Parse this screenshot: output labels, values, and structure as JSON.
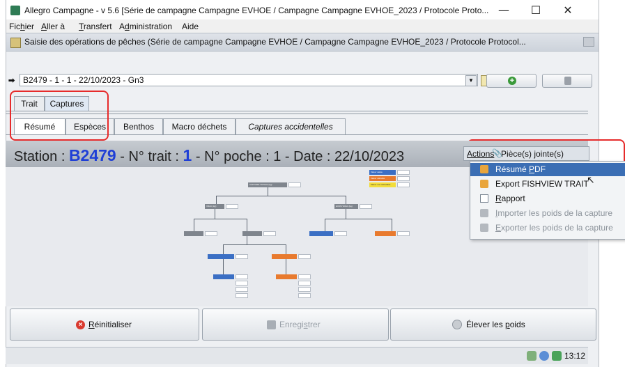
{
  "window": {
    "title": "Allegro Campagne - v 5.6 [Série de campagne Campagne EVHOE / Campagne Campagne EVHOE_2023 / Protocole Proto...",
    "min": "—",
    "max": "☐",
    "close": "✕"
  },
  "menubar": {
    "items": [
      {
        "pre": "Fic",
        "u": "h",
        "post": "ier"
      },
      {
        "pre": "",
        "u": "A",
        "post": "ller à"
      },
      {
        "pre": "",
        "u": "T",
        "post": "ransfert"
      },
      {
        "pre": "A",
        "u": "d",
        "post": "ministration"
      },
      {
        "pre": "Aide",
        "u": "",
        "post": ""
      }
    ]
  },
  "subwindow": {
    "title": "Saisie des opérations de pêches (Série de campagne Campagne EVHOE / Campagne Campagne EVHOE_2023 / Protocole Protocol..."
  },
  "selector": {
    "value": "B2479 - 1 - 1 - 22/10/2023 - Gn3"
  },
  "tabs_main": [
    {
      "label": "Trait",
      "active": false
    },
    {
      "label": "Captures",
      "active": true
    }
  ],
  "tabs_sub": [
    {
      "label": "Résumé",
      "active": true
    },
    {
      "label": "Espèces",
      "active": false
    },
    {
      "label": "Benthos",
      "active": false
    },
    {
      "label": "Macro déchets",
      "active": false
    },
    {
      "label": "Captures accidentelles",
      "active": false
    }
  ],
  "station": {
    "p1": "Station : ",
    "station_id": "B2479",
    "p2": " - N° trait : ",
    "trait_no": "1",
    "p3": " - N° poche : 1 - Date : 22/10/2023"
  },
  "actions": {
    "label": "Actions",
    "attachments": "Pièce(s) jointe(s)"
  },
  "actions_menu": [
    {
      "pre": "Résumé ",
      "u": "P",
      "post": "DF",
      "highlighted": true,
      "disabled": false
    },
    {
      "pre": "Export FISHVIEW TRAIT",
      "u": "",
      "post": "",
      "highlighted": false,
      "disabled": false
    },
    {
      "pre": "",
      "u": "R",
      "post": "apport",
      "highlighted": false,
      "disabled": false
    },
    {
      "pre": "",
      "u": "I",
      "post": "mporter les poids de la capture",
      "highlighted": false,
      "disabled": true
    },
    {
      "pre": "",
      "u": "E",
      "post": "xporter les poids de la capture",
      "highlighted": false,
      "disabled": true
    }
  ],
  "bottom_buttons": [
    {
      "pre": "",
      "u": "R",
      "post": "éinitialiser",
      "enabled": true
    },
    {
      "pre": "Enregi",
      "u": "s",
      "post": "trer",
      "enabled": false
    },
    {
      "pre": "Élever les ",
      "u": "p",
      "post": "oids",
      "enabled": true
    }
  ],
  "status": {
    "clock": "13:12"
  },
  "diagram": {
    "root": "CAPTURE TOTALE (kg)",
    "vrac": "VRAC (kg)",
    "hors_vrac": "HORS VRAC (kg)",
    "legend": [
      "Valeur saisie",
      "Valeur calculée",
      "Valeur non calculable"
    ]
  },
  "colors": {
    "accent": "#1f3fd6",
    "highlight": "#3b6eb4",
    "annotation": "#e62b2b"
  }
}
